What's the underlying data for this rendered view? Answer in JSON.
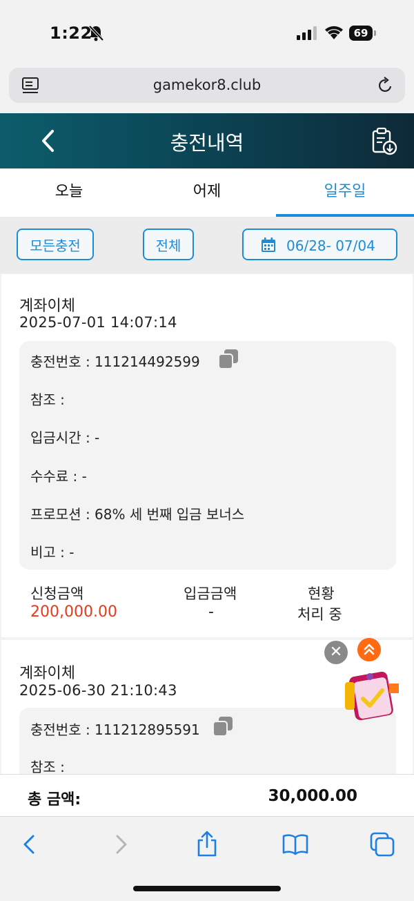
{
  "status_bar": {
    "time": "1:22",
    "battery": "69"
  },
  "browser": {
    "url": "gamekor8.club"
  },
  "header": {
    "title": "충전내역"
  },
  "tabs": [
    {
      "label": "오늘",
      "active": false
    },
    {
      "label": "어제",
      "active": false
    },
    {
      "label": "일주일",
      "active": true
    }
  ],
  "filters": {
    "type_label": "모든충전",
    "status_label": "전체",
    "date_range": "06/28- 07/04"
  },
  "records": [
    {
      "type": "계좌이체",
      "datetime": "2025-07-01 14:07:14",
      "charge_no": "충전번호 : 111214492599",
      "reference": "참조 :",
      "deposit_time": "입금시간 : -",
      "fee": "수수료 : -",
      "promotion": "프로모션 : 68% 세 번째 입금 보너스",
      "note": "비고 : -",
      "requested_label": "신청금액",
      "requested_amount": "200,000.00",
      "deposited_label": "입금금액",
      "deposited_amount": "-",
      "status_label": "현황",
      "status_value": "처리 중"
    },
    {
      "type": "계좌이체",
      "datetime": "2025-06-30 21:10:43",
      "charge_no": "충전번호 : 111212895591",
      "reference": "참조 :"
    }
  ],
  "total": {
    "label": "총 금액:",
    "value": "30,000.00"
  },
  "colors": {
    "accent": "#1d8cd8",
    "amount_red": "#e8391d",
    "header_dark": "#0b4656",
    "scroll_top": "#ff6a13"
  }
}
